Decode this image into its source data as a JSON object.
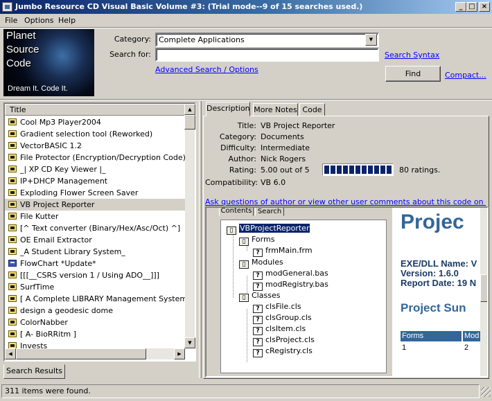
{
  "window": {
    "title": "Jumbo Resource CD Visual Basic Volume #3: (Trial mode--9 of 15 searches used.)",
    "minimize": "_",
    "maximize": "□",
    "close": "×"
  },
  "menu": [
    "File",
    "Options",
    "Help"
  ],
  "logo": {
    "line1": "Planet",
    "line2": "Source",
    "line3": "Code",
    "tagline": "Dream It.  Code It."
  },
  "search": {
    "category_label": "Category:",
    "category_value": "Complete Applications",
    "search_for_label": "Search for:",
    "search_value": "",
    "search_syntax_link": "Search Syntax",
    "advanced_link": "Advanced Search / Options",
    "find_button": "Find",
    "compact_link": "Compact..."
  },
  "results": {
    "column_title": "Title",
    "tab_label": "Search Results",
    "items": [
      {
        "title": "Cool Mp3 Player2004",
        "icon": "code-icon"
      },
      {
        "title": "Gradient selection tool (Reworked)",
        "icon": "code-icon"
      },
      {
        "title": "VectorBASIC 1.2",
        "icon": "code-icon"
      },
      {
        "title": "File Protector (Encryption/Decryption Code)",
        "icon": "code-icon"
      },
      {
        "title": "_| XP CD Key Viewer  |_",
        "icon": "code-icon"
      },
      {
        "title": "IP+DHCP Management",
        "icon": "code-icon"
      },
      {
        "title": "Exploding Flower Screen Saver",
        "icon": "code-icon"
      },
      {
        "title": "VB Project Reporter",
        "icon": "code-icon",
        "selected": true
      },
      {
        "title": "File Kutter",
        "icon": "code-icon"
      },
      {
        "title": "[^ Text converter (Binary/Hex/Asc/Oct) ^]",
        "icon": "code-icon"
      },
      {
        "title": "OE Email Extractor",
        "icon": "code-icon"
      },
      {
        "title": "_A Student Library System_",
        "icon": "code-icon"
      },
      {
        "title": "FlowChart *Update*",
        "icon": "book-icon"
      },
      {
        "title": "[[[__CSRS version 1 / Using ADO__]]]",
        "icon": "code-icon"
      },
      {
        "title": "SurfTime",
        "icon": "code-icon"
      },
      {
        "title": "[ A Complete LIBRARY  Management System  NEW",
        "icon": "code-icon"
      },
      {
        "title": "design a geodesic dome",
        "icon": "code-icon"
      },
      {
        "title": "ColorNabber",
        "icon": "code-icon"
      },
      {
        "title": "[    A- BioRRitm    ]",
        "icon": "code-icon"
      },
      {
        "title": "Invests",
        "icon": "code-icon"
      }
    ]
  },
  "detail_tabs": [
    "Description",
    "More Notes",
    "Code"
  ],
  "description": {
    "labels": {
      "title": "Title:",
      "category": "Category:",
      "difficulty": "Difficulty:",
      "author": "Author:",
      "rating": "Rating:",
      "compatibility": "Compatibility:"
    },
    "title": "VB Project Reporter",
    "category": "Documents",
    "difficulty": "Intermediate",
    "author": "Nick Rogers",
    "rating": "5.00 out of 5",
    "rating_fraction": 1.0,
    "ratings_count": "80 ratings.",
    "compatibility": "VB 6.0",
    "ask_link": "Ask questions of author or view other user comments about this code on the web..."
  },
  "help_viewer": {
    "tabs": [
      "Contents",
      "Search"
    ],
    "tree": {
      "root": "VBProjectReporter",
      "forms_label": "Forms",
      "forms": [
        "frmMain.frm"
      ],
      "modules_label": "Modules",
      "modules": [
        "modGeneral.bas",
        "modRegistry.bas"
      ],
      "classes_label": "Classes",
      "classes": [
        "clsFile.cls",
        "clsGroup.cls",
        "clsItem.cls",
        "clsProject.cls",
        "cRegistry.cls"
      ]
    },
    "doc": {
      "heading": "Projec",
      "exe_line": "EXE/DLL Name: V",
      "version_line": "Version: 1.6.0",
      "report_line": "Report Date: 19 N",
      "summary_heading": "Project Sun",
      "table_headers": [
        "Forms",
        "Mod"
      ],
      "table_values": [
        "1",
        "2"
      ],
      "colors": {
        "heading": "#336699",
        "table_header_bg": "#336699"
      }
    }
  },
  "status": {
    "text": "311 items were found."
  }
}
